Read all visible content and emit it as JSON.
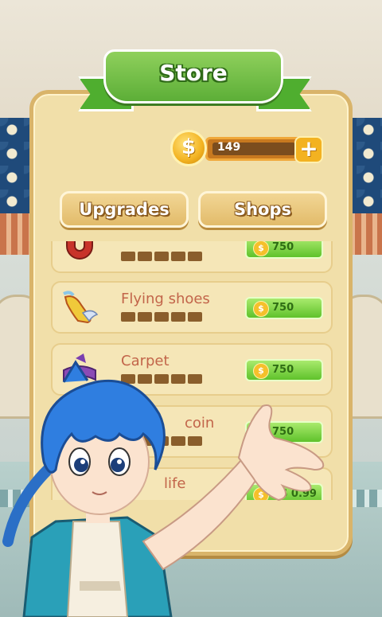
{
  "store": {
    "title": "Store",
    "coins": "149",
    "coin_symbol": "$",
    "add_coins_label": "+"
  },
  "tabs": [
    {
      "label": "Upgrades"
    },
    {
      "label": "Shops"
    }
  ],
  "items": [
    {
      "name": "",
      "price": "750",
      "icon": "magnet-icon"
    },
    {
      "name": "Flying shoes",
      "price": "750",
      "icon": "winged-shoe-icon"
    },
    {
      "name": "Carpet",
      "price": "750",
      "icon": "carpet-icon"
    },
    {
      "name": "coin",
      "price": "750",
      "icon": "coin-icon"
    },
    {
      "name": "life",
      "price": "RS 0.99",
      "icon": "heart-icon"
    }
  ],
  "colors": {
    "ribbon_green": "#5cae37",
    "panel_cream": "#f1dfa9",
    "buy_green": "#5fc22b",
    "item_text": "#c2654a"
  }
}
